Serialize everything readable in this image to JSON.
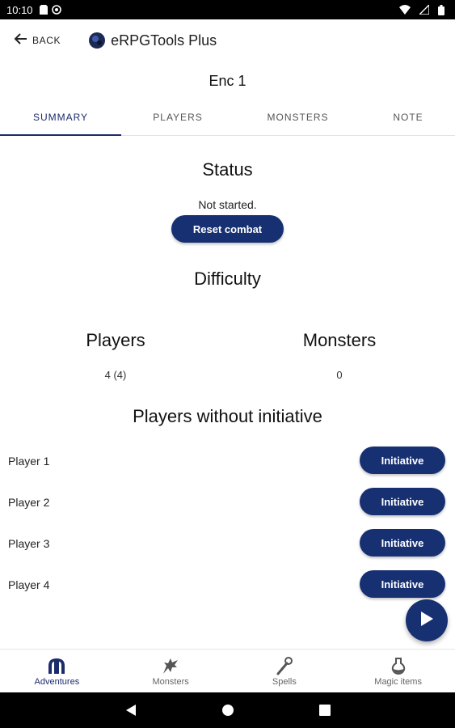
{
  "status_bar": {
    "time": "10:10"
  },
  "app_bar": {
    "back_label": "BACK",
    "title": "eRPGTools Plus"
  },
  "encounter_title": "Enc 1",
  "tabs": [
    {
      "label": "SUMMARY",
      "active": true
    },
    {
      "label": "PLAYERS",
      "active": false
    },
    {
      "label": "MONSTERS",
      "active": false
    },
    {
      "label": "NOTE",
      "active": false
    }
  ],
  "status": {
    "heading": "Status",
    "text": "Not started.",
    "reset_label": "Reset combat"
  },
  "difficulty": {
    "heading": "Difficulty"
  },
  "summary": {
    "players_heading": "Players",
    "players_value": "4 (4)",
    "monsters_heading": "Monsters",
    "monsters_value": "0"
  },
  "players_without_initiative": {
    "heading": "Players without initiative",
    "button_label": "Initiative",
    "players": [
      "Player 1",
      "Player 2",
      "Player 3",
      "Player 4"
    ]
  },
  "bottom_nav": [
    {
      "label": "Adventures",
      "icon": "adventures-icon",
      "active": true
    },
    {
      "label": "Monsters",
      "icon": "dragon-icon",
      "active": false
    },
    {
      "label": "Spells",
      "icon": "wand-icon",
      "active": false
    },
    {
      "label": "Magic items",
      "icon": "potion-icon",
      "active": false
    }
  ],
  "colors": {
    "primary": "#173072",
    "tab_active": "#1b2c6b"
  }
}
